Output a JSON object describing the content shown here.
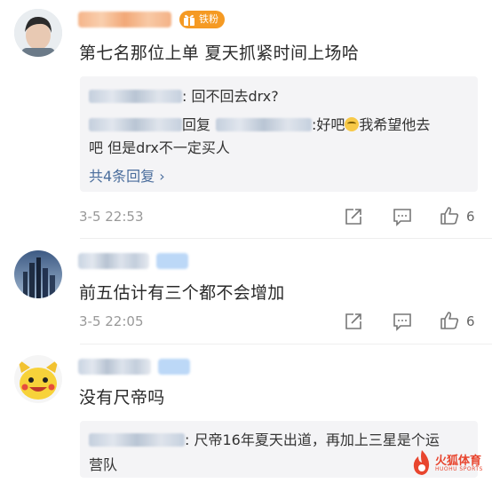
{
  "comments": [
    {
      "text": "第七名那位上单 夏天抓紧时间上场哈",
      "badge": "铁粉",
      "replies": [
        {
          "text": ": 回不回去drx?"
        },
        {
          "prefix": "回复",
          "text_a": ":好吧",
          "text_b": "我希望他去",
          "text_c": "吧 但是drx不一定买人"
        }
      ],
      "more_replies": "共4条回复 ›",
      "time": "3-5 22:53",
      "likes": "6"
    },
    {
      "text": "前五估计有三个都不会增加",
      "time": "3-5 22:05",
      "likes": "6"
    },
    {
      "text": "没有尺帝吗",
      "replies": [
        {
          "text_a": ": 尺帝16年夏天出道，再加上三星是个运",
          "text_b": "营队"
        }
      ]
    }
  ],
  "icons": {
    "share": "share-icon",
    "comment": "comment-icon",
    "like": "thumbs-up-icon",
    "badge": "gift-icon"
  },
  "colors": {
    "link": "#4a6d9c",
    "time": "#999999",
    "badge": "#f59a23",
    "watermark": "#e8452e"
  },
  "watermark": {
    "line1": "火狐体育",
    "line2": "HUOHU SPORTS"
  }
}
